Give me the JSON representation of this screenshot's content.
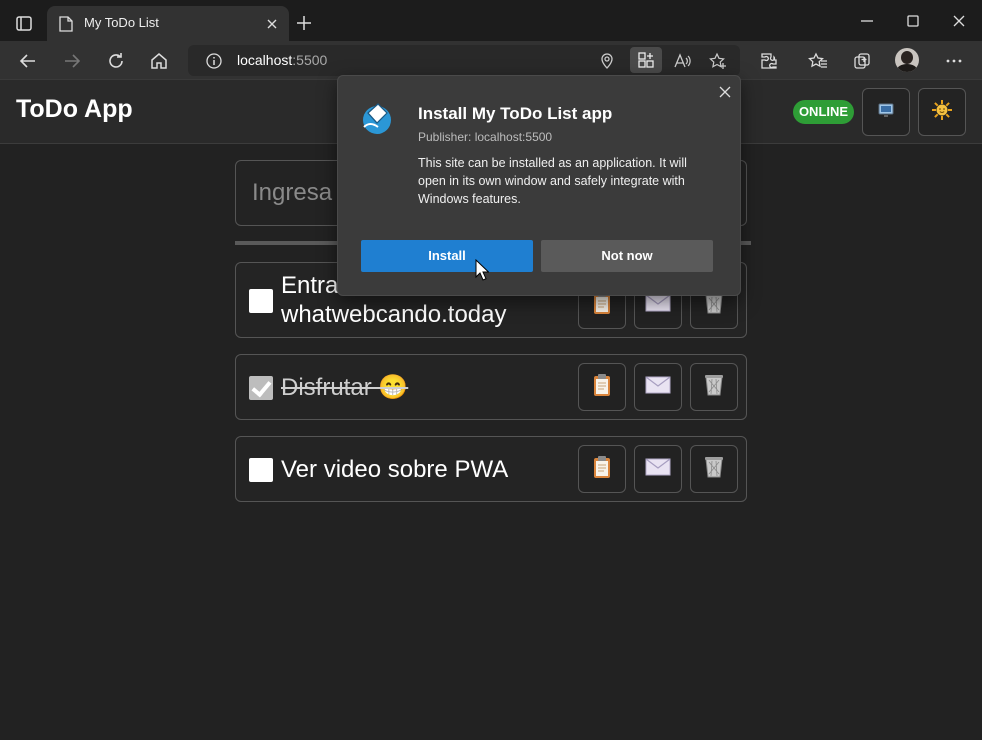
{
  "browser": {
    "tab_title": "My ToDo List",
    "address_host": "localhost",
    "address_port": ":5500"
  },
  "app": {
    "title": "ToDo App",
    "status": "ONLINE",
    "input_placeholder": "Ingresa"
  },
  "todos": [
    {
      "line1": "Entra",
      "line2": "whatwebcando.today",
      "done": false
    },
    {
      "text": "Disfrutar 😁",
      "done": true
    },
    {
      "text": "Ver video sobre PWA",
      "done": false
    }
  ],
  "dialog": {
    "title": "Install My ToDo List app",
    "publisher": "Publisher: localhost:5500",
    "description": "This site can be installed as an application. It will open in its own window and safely integrate with Windows features.",
    "install_label": "Install",
    "not_now_label": "Not now"
  },
  "colors": {
    "accent": "#1f7fd1",
    "online": "#2e9d36"
  }
}
